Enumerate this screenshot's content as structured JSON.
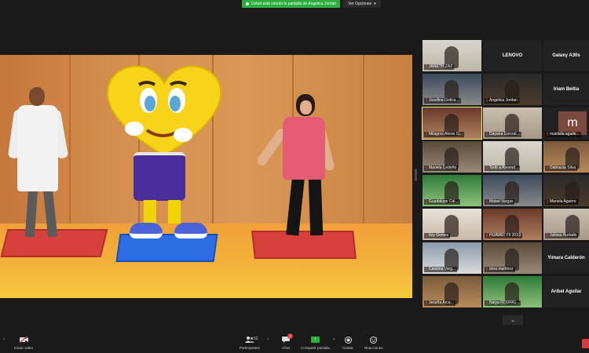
{
  "banner": {
    "sharing_text": "Usted está viendo la pantalla de Angelica Jordan",
    "view_options_label": "Ver Opciones"
  },
  "gallery": {
    "tiles": [
      {
        "name": "JANETH ZAZ",
        "type": "video"
      },
      {
        "name": "LENOVO",
        "type": "name"
      },
      {
        "name": "Galaxy A30s",
        "type": "name"
      },
      {
        "name": "Josefina Gotica...",
        "type": "video"
      },
      {
        "name": "Angelica Jordan",
        "type": "video"
      },
      {
        "name": "Iriam Beitia",
        "type": "name"
      },
      {
        "name": "Milagros Alexis G...",
        "type": "video",
        "active": true
      },
      {
        "name": "Dayana Gonzal...",
        "type": "video"
      },
      {
        "name": "maidalia aguile...",
        "type": "avatar",
        "initial": "m"
      },
      {
        "name": "Mariela Cedeño",
        "type": "video"
      },
      {
        "name": "Torib a Alvarad...",
        "type": "video"
      },
      {
        "name": "Dalmacia Silva",
        "type": "video"
      },
      {
        "name": "Guadalupe Cal...",
        "type": "video"
      },
      {
        "name": "Mabel Vargas",
        "type": "video"
      },
      {
        "name": "Mariela Aguirre",
        "type": "video"
      },
      {
        "name": "Itzy Gomez",
        "type": "video"
      },
      {
        "name": "HUAWEI Y9 2019",
        "type": "video"
      },
      {
        "name": "Julissa Hurtado",
        "type": "video"
      },
      {
        "name": "Catalina Varg...",
        "type": "video"
      },
      {
        "name": "dora martinez",
        "type": "video"
      },
      {
        "name": "Yimara Calderón",
        "type": "name"
      },
      {
        "name": "Jeseña Arca...",
        "type": "video"
      },
      {
        "name": "Nalya RODRIG...",
        "type": "video"
      },
      {
        "name": "Aribel Aguilar",
        "type": "name"
      }
    ]
  },
  "toolbar": {
    "start_video": "Iniciar video",
    "participants": "Participantes",
    "participants_count": "52",
    "chat": "Chat",
    "chat_badge": "2",
    "share_screen": "Compartir pantalla",
    "record": "Grabar",
    "reactions": "Reacciones"
  },
  "colors": {
    "share_green": "#2dad3c",
    "active_border": "#f0f07a",
    "end_red": "#d93a3a"
  },
  "icons": {
    "start_video": "video-camera-off-icon",
    "participants": "people-icon",
    "chat": "chat-bubble-icon",
    "share": "share-screen-arrow-icon",
    "record": "record-dot-icon",
    "reactions": "smiley-plus-icon"
  }
}
